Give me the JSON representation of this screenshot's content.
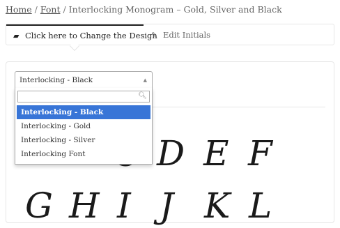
{
  "breadcrumb": {
    "home": "Home",
    "font": "Font",
    "current": "Interlocking Monogram – Gold, Silver and Black",
    "sep": "/"
  },
  "tabs": {
    "design": "Click here to Change the Design",
    "initials": "Edit Initials"
  },
  "select": {
    "selected": "Interlocking - Black",
    "search_placeholder": "",
    "options": [
      "Interlocking - Black",
      "Interlocking - Gold",
      "Interlocking - Silver",
      "Interlocking Font"
    ]
  },
  "glyphs": [
    "C",
    "D",
    "E",
    "F",
    "G",
    "H",
    "I",
    "J",
    "K",
    "L"
  ],
  "icons": {
    "design_tab": "folder-open-icon",
    "initials_tab": "edit-icon",
    "select_arrow": "arrow-up-icon",
    "search": "search-icon"
  }
}
